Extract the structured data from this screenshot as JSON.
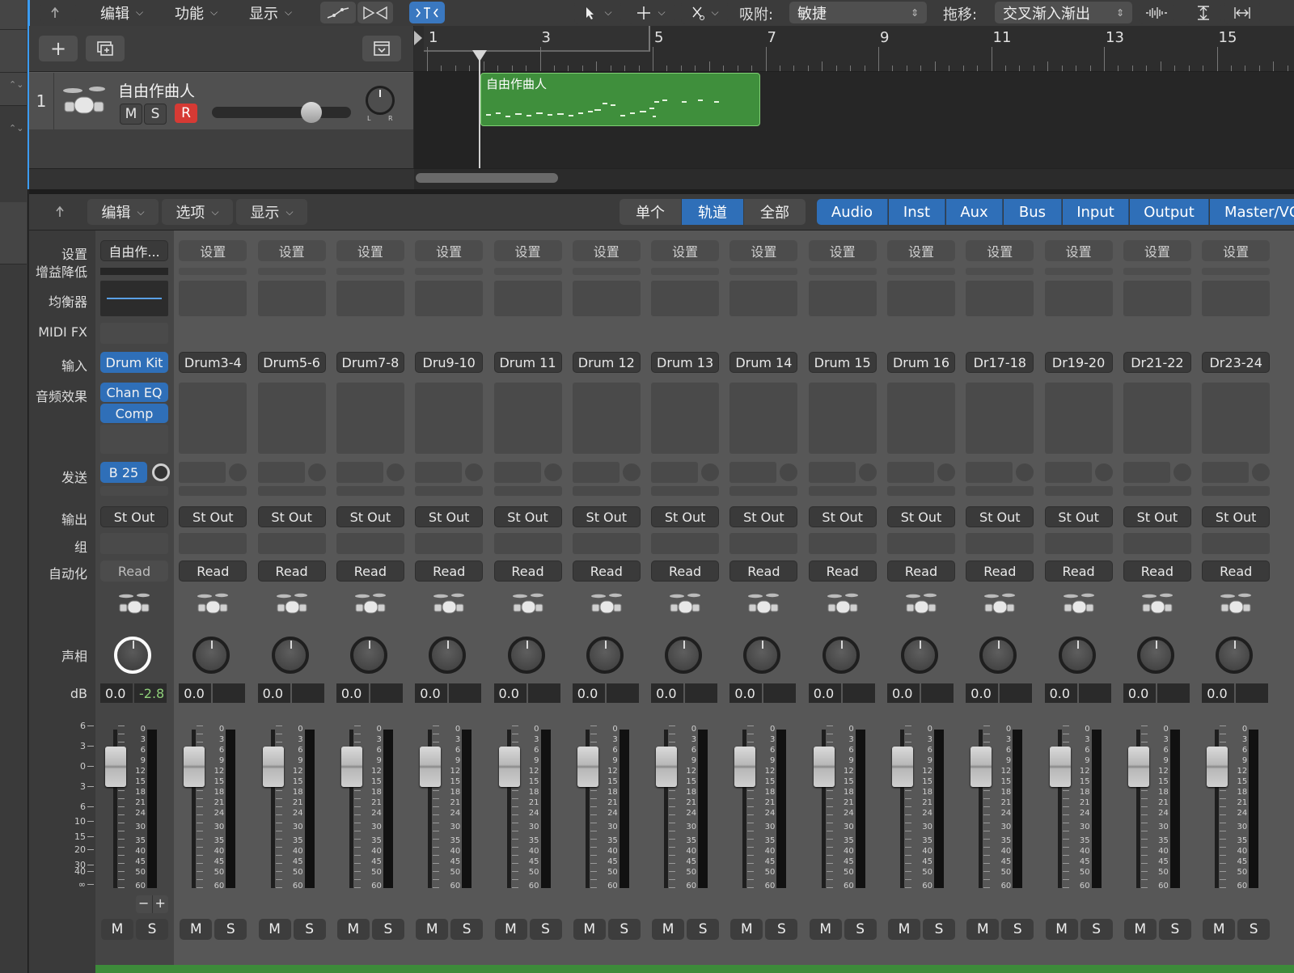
{
  "toolbar": {
    "menus": [
      "编辑",
      "功能",
      "显示"
    ],
    "snap_label": "吸附:",
    "snap_value": "敏捷",
    "drag_label": "拖移:",
    "drag_value": "交叉渐入渐出"
  },
  "arrange": {
    "ruler_bars": [
      "1",
      "3",
      "5",
      "7",
      "9",
      "11",
      "13",
      "15"
    ],
    "track": {
      "number": "1",
      "name": "自由作曲人",
      "mute": "M",
      "solo": "S",
      "record": "R",
      "pan_left": "L",
      "pan_right": "R"
    },
    "region_name": "自由作曲人"
  },
  "mixer": {
    "menus": [
      "编辑",
      "选项",
      "显示"
    ],
    "view_modes": [
      "单个",
      "轨道",
      "全部"
    ],
    "active_view_mode": "轨道",
    "filters": [
      "Audio",
      "Inst",
      "Aux",
      "Bus",
      "Input",
      "Output",
      "Master/VCA"
    ],
    "row_labels": {
      "setting": "设置",
      "gain": "增益降低",
      "eq": "均衡器",
      "midifx": "MIDI FX",
      "input": "输入",
      "audiofx": "音频效果",
      "send": "发送",
      "output": "输出",
      "group": "组",
      "automation": "自动化",
      "pan": "声相",
      "db": "dB"
    },
    "left_scale": [
      "6",
      "3",
      "0",
      "3",
      "6",
      "10",
      "15",
      "20",
      "30",
      "40",
      "∞"
    ],
    "meter_scale": [
      "0",
      "3",
      "6",
      "9",
      "12",
      "15",
      "18",
      "21",
      "24",
      "30",
      "35",
      "40",
      "45",
      "50",
      "60"
    ],
    "fader_buttons": {
      "minus": "−",
      "plus": "+"
    },
    "channels": [
      {
        "setting": "自由作...",
        "input": "Drum Kit",
        "fx": [
          "Chan EQ",
          "Comp"
        ],
        "send": "B 25",
        "output": "St Out",
        "automation": "Read",
        "db": "0.0",
        "peak": "-2.8",
        "mute": "M",
        "solo": "S"
      },
      {
        "setting": "设置",
        "input": "Drum3-4",
        "output": "St Out",
        "automation": "Read",
        "db": "0.0",
        "peak": "",
        "mute": "M",
        "solo": "S"
      },
      {
        "setting": "设置",
        "input": "Drum5-6",
        "output": "St Out",
        "automation": "Read",
        "db": "0.0",
        "peak": "",
        "mute": "M",
        "solo": "S"
      },
      {
        "setting": "设置",
        "input": "Drum7-8",
        "output": "St Out",
        "automation": "Read",
        "db": "0.0",
        "peak": "",
        "mute": "M",
        "solo": "S"
      },
      {
        "setting": "设置",
        "input": "Dru9-10",
        "output": "St Out",
        "automation": "Read",
        "db": "0.0",
        "peak": "",
        "mute": "M",
        "solo": "S"
      },
      {
        "setting": "设置",
        "input": "Drum 11",
        "output": "St Out",
        "automation": "Read",
        "db": "0.0",
        "peak": "",
        "mute": "M",
        "solo": "S"
      },
      {
        "setting": "设置",
        "input": "Drum 12",
        "output": "St Out",
        "automation": "Read",
        "db": "0.0",
        "peak": "",
        "mute": "M",
        "solo": "S"
      },
      {
        "setting": "设置",
        "input": "Drum 13",
        "output": "St Out",
        "automation": "Read",
        "db": "0.0",
        "peak": "",
        "mute": "M",
        "solo": "S"
      },
      {
        "setting": "设置",
        "input": "Drum 14",
        "output": "St Out",
        "automation": "Read",
        "db": "0.0",
        "peak": "",
        "mute": "M",
        "solo": "S"
      },
      {
        "setting": "设置",
        "input": "Drum 15",
        "output": "St Out",
        "automation": "Read",
        "db": "0.0",
        "peak": "",
        "mute": "M",
        "solo": "S"
      },
      {
        "setting": "设置",
        "input": "Drum 16",
        "output": "St Out",
        "automation": "Read",
        "db": "0.0",
        "peak": "",
        "mute": "M",
        "solo": "S"
      },
      {
        "setting": "设置",
        "input": "Dr17-18",
        "output": "St Out",
        "automation": "Read",
        "db": "0.0",
        "peak": "",
        "mute": "M",
        "solo": "S"
      },
      {
        "setting": "设置",
        "input": "Dr19-20",
        "output": "St Out",
        "automation": "Read",
        "db": "0.0",
        "peak": "",
        "mute": "M",
        "solo": "S"
      },
      {
        "setting": "设置",
        "input": "Dr21-22",
        "output": "St Out",
        "automation": "Read",
        "db": "0.0",
        "peak": "",
        "mute": "M",
        "solo": "S"
      },
      {
        "setting": "设置",
        "input": "Dr23-24",
        "output": "St Out",
        "automation": "Read",
        "db": "0.0",
        "peak": "",
        "mute": "M",
        "solo": "S"
      }
    ]
  },
  "colors": {
    "accent_blue": "#2f6fb8",
    "region_green": "#3f8f3c",
    "record_red": "#d63a34",
    "selection_blue": "#3b9cf2"
  }
}
